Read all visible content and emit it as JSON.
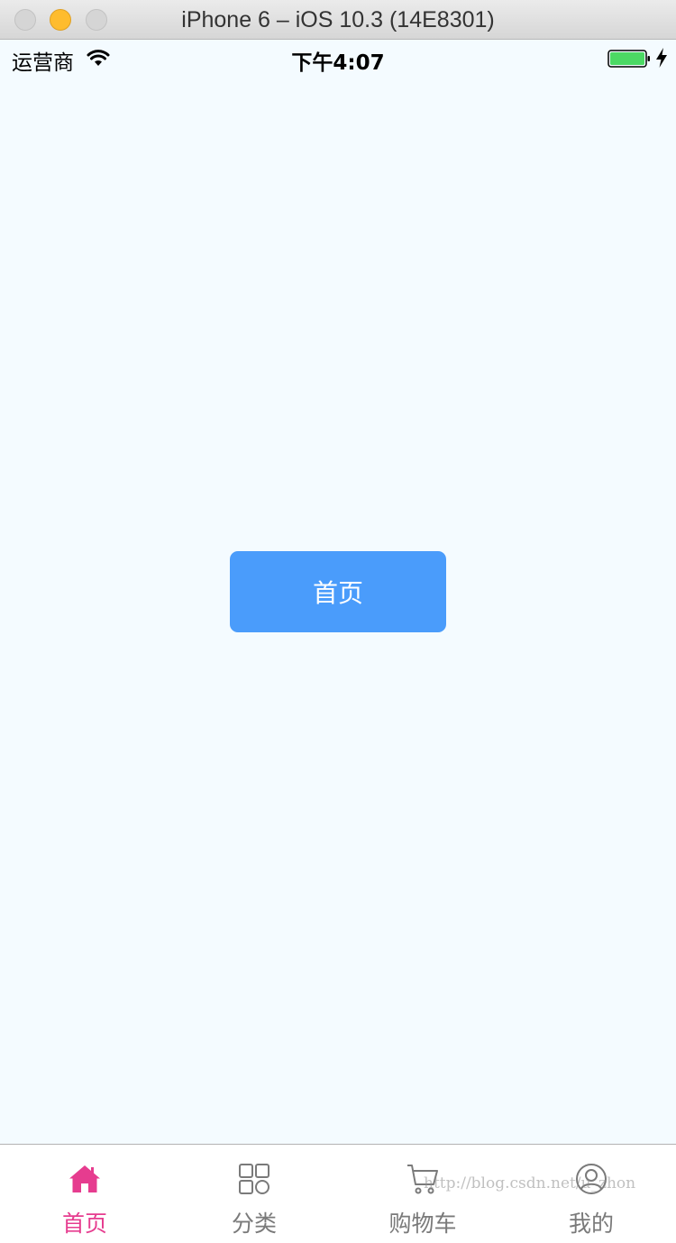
{
  "window": {
    "title": "iPhone 6 – iOS 10.3 (14E8301)"
  },
  "statusbar": {
    "carrier": "运营商",
    "time": "下午4:07",
    "battery_color": "#4cd964"
  },
  "main": {
    "button_label": "首页",
    "button_color": "#4a9cfb",
    "background": "#f4fbff"
  },
  "tabbar": {
    "active_color": "#e63c8f",
    "inactive_color": "#7a7a7a",
    "tabs": [
      {
        "label": "首页",
        "icon": "home-icon",
        "active": true
      },
      {
        "label": "分类",
        "icon": "grid-icon",
        "active": false
      },
      {
        "label": "购物车",
        "icon": "cart-icon",
        "active": false
      },
      {
        "label": "我的",
        "icon": "user-icon",
        "active": false
      }
    ]
  },
  "watermark": "http://blog.csdn.net/u_zhon"
}
